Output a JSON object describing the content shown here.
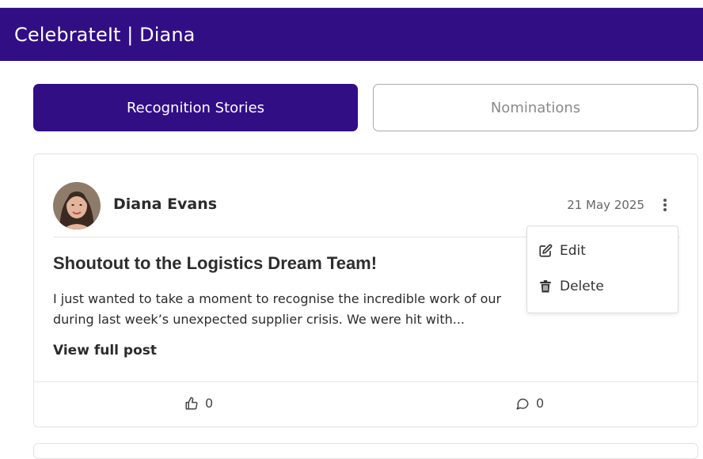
{
  "app": {
    "title": "CelebrateIt | Diana"
  },
  "tabs": [
    {
      "label": "Recognition Stories",
      "active": true
    },
    {
      "label": "Nominations",
      "active": false
    }
  ],
  "post": {
    "author": "Diana Evans",
    "date": "21 May 2025",
    "title": "Shoutout to the Logistics Dream Team!",
    "excerpt_line1": "I just wanted to take a moment to recognise the incredible work of our",
    "excerpt_line2": "during last week’s unexpected supplier crisis. We were hit with...",
    "view_full_label": "View full post",
    "likes": "0",
    "comments": "0"
  },
  "menu": {
    "edit_label": "Edit",
    "delete_label": "Delete"
  },
  "colors": {
    "brand": "#320e85",
    "border": "#e3e3e3"
  },
  "icons": [
    "user-avatar",
    "more-vertical-icon",
    "edit-icon",
    "trash-icon",
    "thumbs-up-icon",
    "comment-icon"
  ]
}
